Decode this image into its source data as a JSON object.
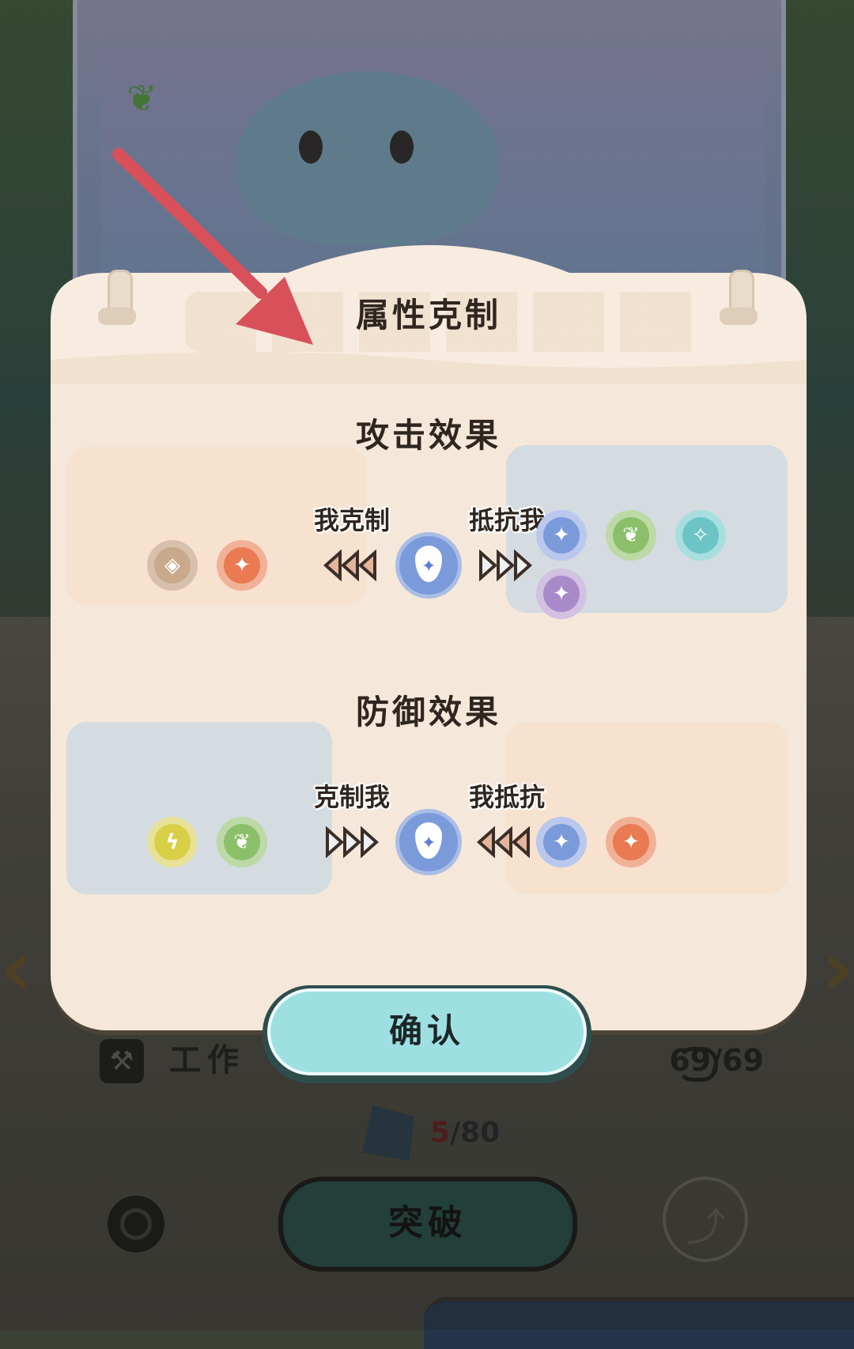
{
  "background": {
    "work_label": "工作",
    "work_value": "69/69",
    "shards_current": "5",
    "shards_total": "/80",
    "breakthrough_label": "突破",
    "nav_left": "‹",
    "nav_right": "›",
    "icons": [
      "sprout-icon",
      "pet-creature",
      "hammer-icon",
      "refresh-icon",
      "evolve-icon",
      "shard-icon"
    ]
  },
  "dialog": {
    "title": "属性克制",
    "attack": {
      "title": "攻击效果",
      "left_label": "我克制",
      "right_label": "抵抗我",
      "weak_targets": [
        "earth",
        "fire"
      ],
      "resisting": [
        "water",
        "grass",
        "ice",
        "dark"
      ]
    },
    "defense": {
      "title": "防御效果",
      "left_label": "克制我",
      "right_label": "我抵抗",
      "weak_to": [
        "electric",
        "grass"
      ],
      "resist": [
        "water",
        "fire"
      ]
    },
    "center_element": "water",
    "confirm_label": "确认"
  },
  "colors": {
    "panel": "#f5e8da",
    "attack_good_zone": "#f8dcc6",
    "bad_zone": "#d4dbe1",
    "confirm": "#9ee0e2",
    "guide_arrow": "#d8505a"
  },
  "element_colors": {
    "earth": "#c9a98b",
    "fire": "#e97a52",
    "water": "#7b9ad9",
    "grass": "#8cbf6a",
    "ice": "#6bc4c6",
    "dark": "#a98ac9",
    "electric": "#d9cf46"
  }
}
